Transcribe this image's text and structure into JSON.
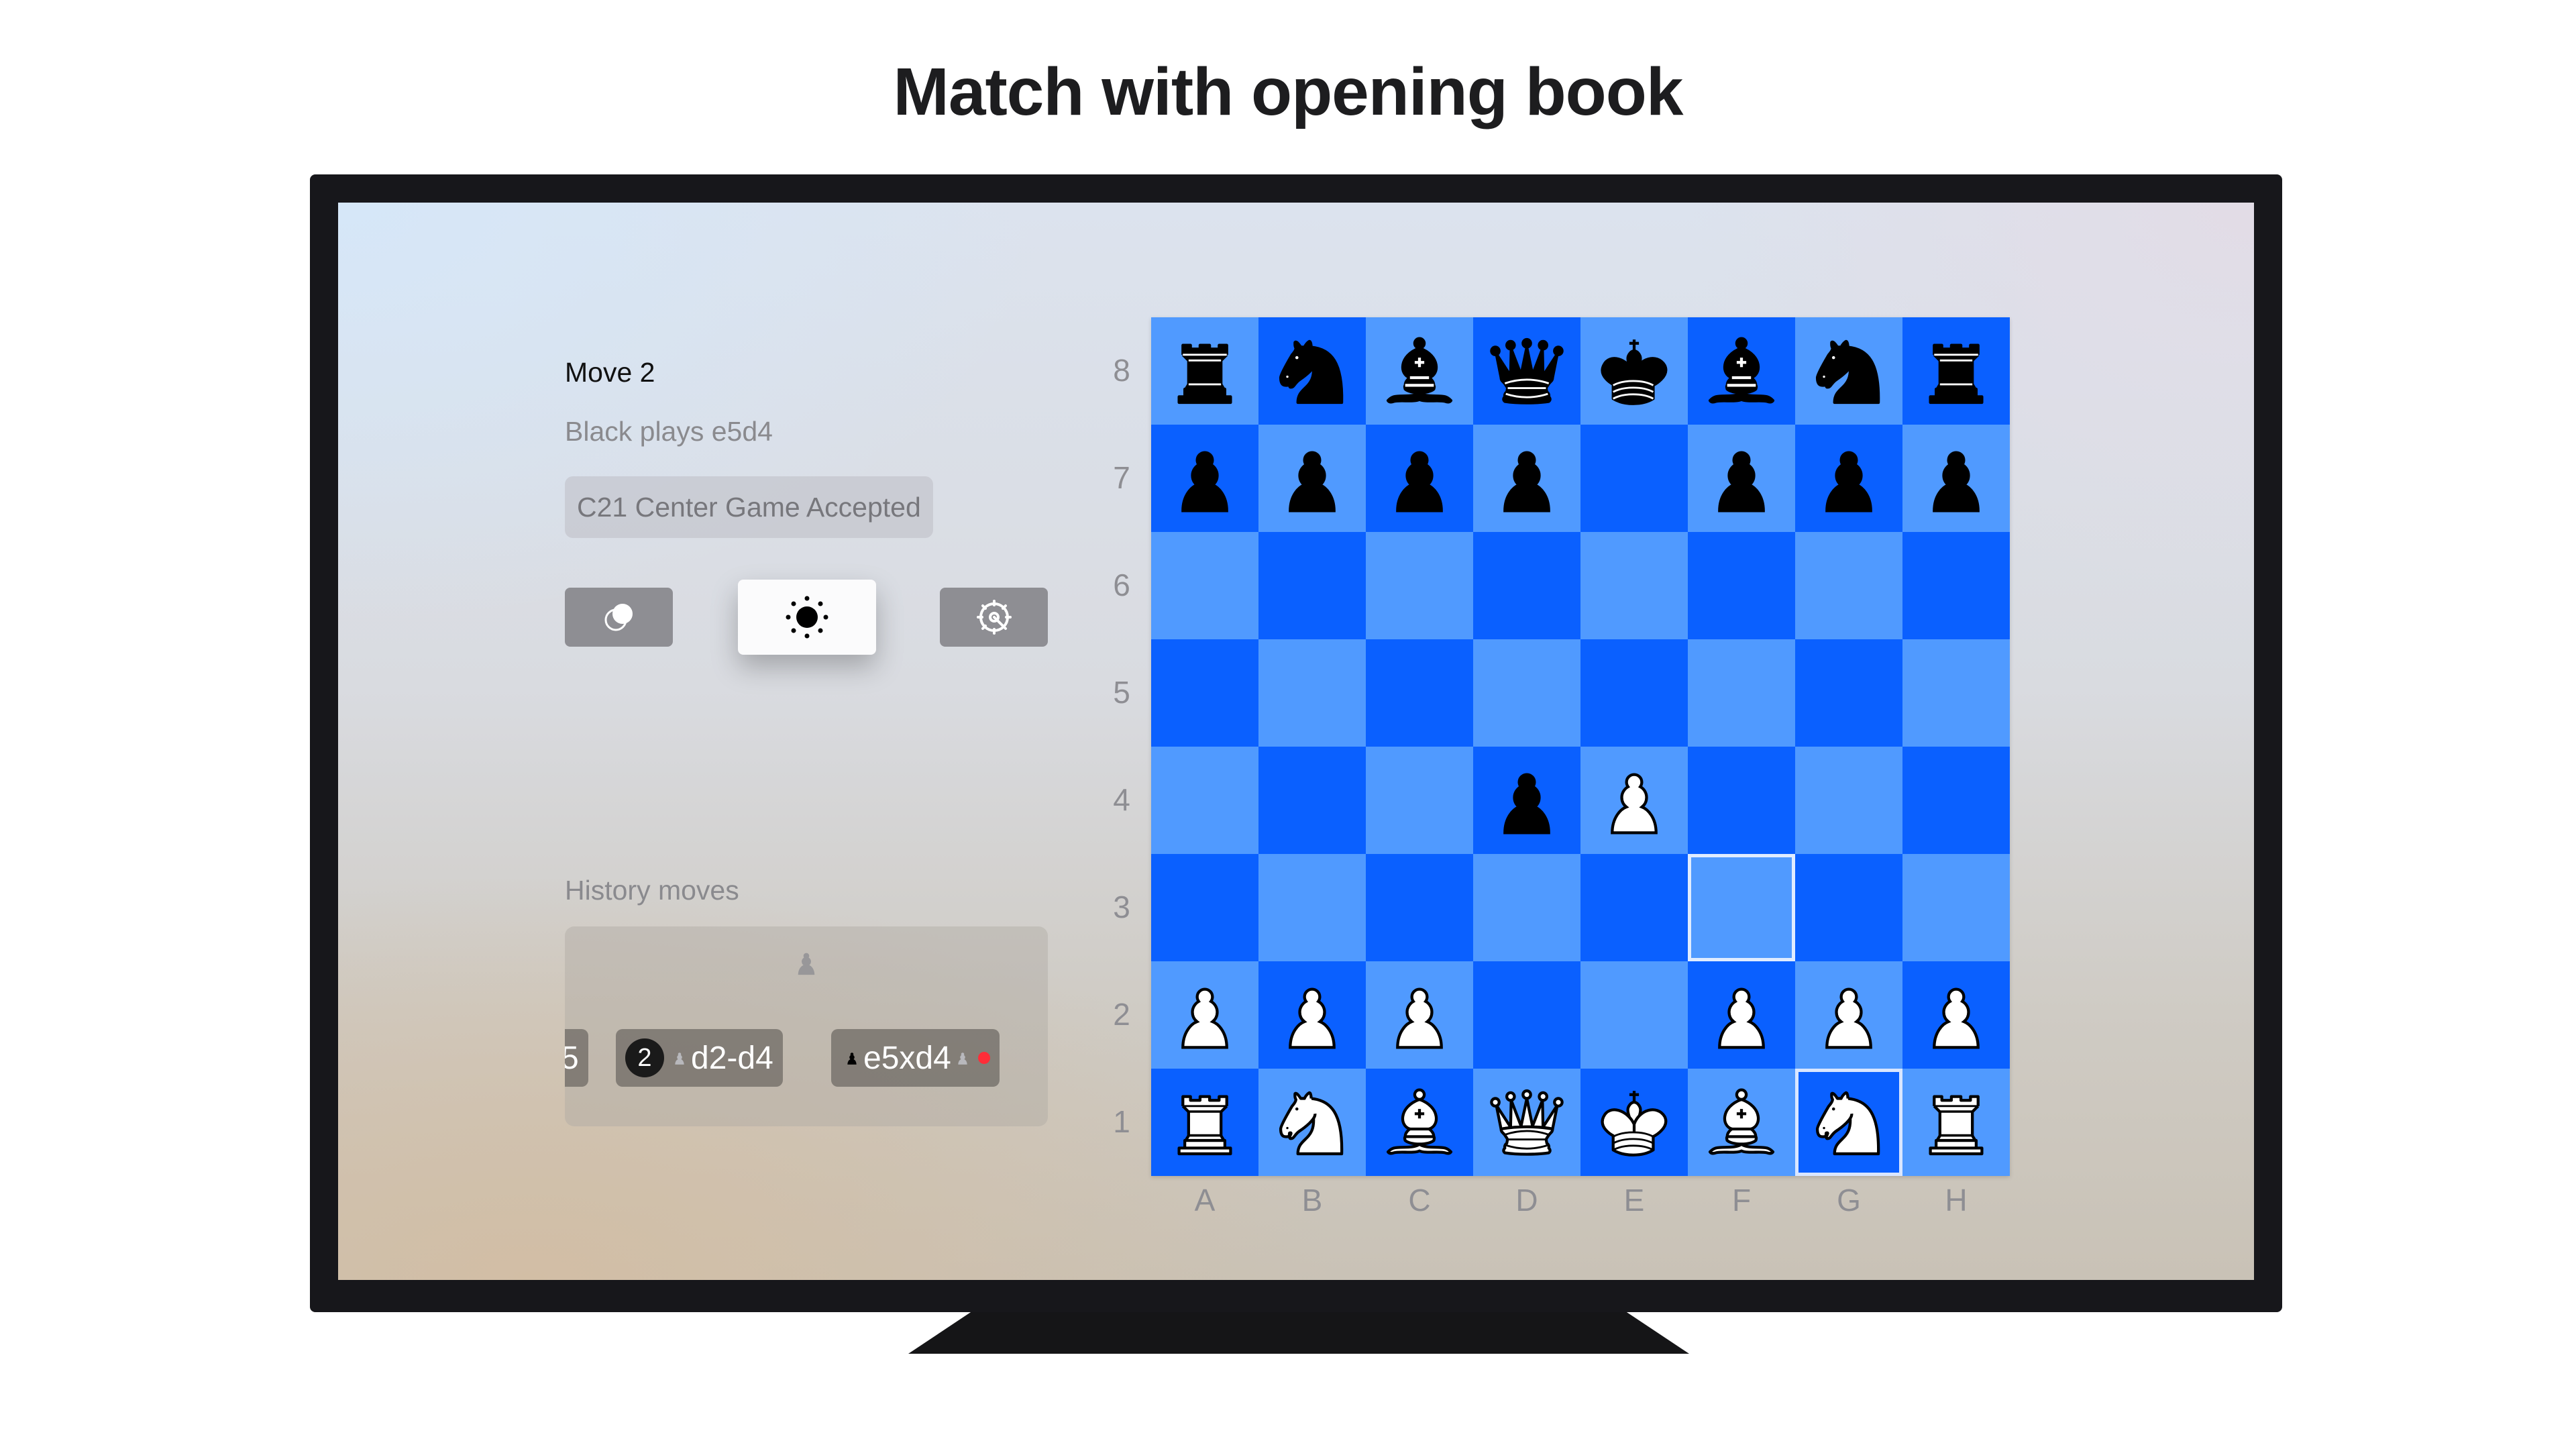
{
  "headline": "Match with opening book",
  "panel": {
    "move_title": "Move 2",
    "move_description": "Black plays e5d4",
    "opening": "C21 Center Game Accepted",
    "history_label": "History moves"
  },
  "controls": [
    {
      "name": "new-game-icon"
    },
    {
      "name": "brightness-icon",
      "focused": true
    },
    {
      "name": "settings-gear-icon"
    }
  ],
  "history": [
    {
      "text": "5",
      "partial": true
    },
    {
      "number": "2",
      "text": "d2-d4",
      "side": "white"
    },
    {
      "text": "e5xd4",
      "side": "black",
      "capture": true,
      "marker_color": "#ff2d38"
    }
  ],
  "board": {
    "ranks": [
      "8",
      "7",
      "6",
      "5",
      "4",
      "3",
      "2",
      "1"
    ],
    "files": [
      "A",
      "B",
      "C",
      "D",
      "E",
      "F",
      "G",
      "H"
    ],
    "pieces": [
      [
        "r",
        "n",
        "b",
        "q",
        "k",
        "b",
        "n",
        "r"
      ],
      [
        "p",
        "p",
        "p",
        "p",
        "",
        "p",
        "p",
        "p"
      ],
      [
        "",
        "",
        "",
        "",
        "",
        "",
        "",
        ""
      ],
      [
        "",
        "",
        "",
        "",
        "",
        "",
        "",
        ""
      ],
      [
        "",
        "",
        "",
        "p",
        "P",
        "",
        "",
        ""
      ],
      [
        "",
        "",
        "",
        "",
        "",
        "",
        "",
        ""
      ],
      [
        "P",
        "P",
        "P",
        "",
        "",
        "P",
        "P",
        "P"
      ],
      [
        "R",
        "N",
        "B",
        "Q",
        "K",
        "B",
        "N",
        "R"
      ]
    ],
    "highlighted_squares": [
      "f3",
      "g1"
    ],
    "colors": {
      "light": "#509aff",
      "dark": "#0a60ff"
    }
  }
}
